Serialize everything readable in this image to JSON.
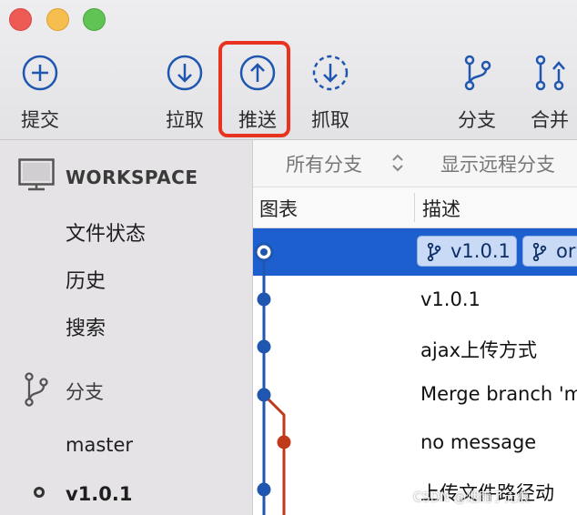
{
  "toolbar": {
    "commit_label": "提交",
    "pull_label": "拉取",
    "push_label": "推送",
    "fetch_label": "抓取",
    "branch_label": "分支",
    "merge_label": "合并"
  },
  "sidebar": {
    "workspace_title": "WORKSPACE",
    "workspace_items": [
      "文件状态",
      "历史",
      "搜索"
    ],
    "branches_title": "分支",
    "branches": [
      "master",
      "v1.0.1"
    ]
  },
  "filter": {
    "all_branches": "所有分支",
    "show_remote": "显示远程分支"
  },
  "columns": {
    "graph": "图表",
    "description": "描述"
  },
  "commits": [
    {
      "description": "",
      "tags": [
        "v1.0.1",
        "origin"
      ]
    },
    {
      "description": "v1.0.1"
    },
    {
      "description": "ajax上传方式"
    },
    {
      "description": "Merge branch 'm"
    },
    {
      "description": "no message"
    },
    {
      "description": "上传文件路径动"
    }
  ],
  "tag_labels": {
    "first": "v1.0.1",
    "second": "or"
  },
  "watermark": "CSDN @烟雨了无痕",
  "colors": {
    "accent_blue": "#1d5fcf",
    "graph_blue": "#1f56b0",
    "graph_red": "#c0391b",
    "highlight_red": "#e8341f"
  }
}
